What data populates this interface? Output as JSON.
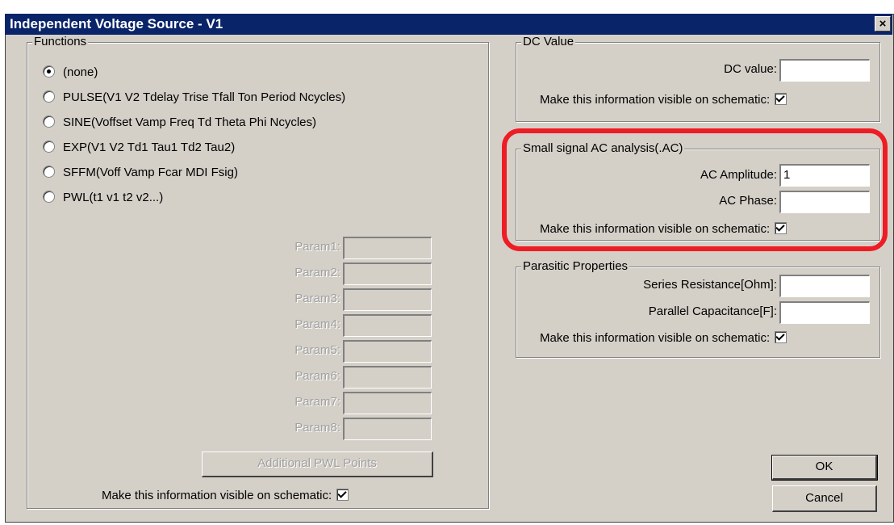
{
  "window": {
    "title": "Independent Voltage Source - V1",
    "close_label": "×"
  },
  "functions": {
    "title": "Functions",
    "options": [
      {
        "label": "(none)",
        "selected": true
      },
      {
        "label": "PULSE(V1 V2 Tdelay Trise Tfall Ton Period Ncycles)",
        "selected": false
      },
      {
        "label": "SINE(Voffset Vamp Freq Td Theta Phi Ncycles)",
        "selected": false
      },
      {
        "label": "EXP(V1 V2 Td1 Tau1 Td2 Tau2)",
        "selected": false
      },
      {
        "label": "SFFM(Voff Vamp Fcar MDI Fsig)",
        "selected": false
      },
      {
        "label": "PWL(t1 v1 t2 v2...)",
        "selected": false
      }
    ],
    "params": [
      {
        "label": "Param1:",
        "value": ""
      },
      {
        "label": "Param2:",
        "value": ""
      },
      {
        "label": "Param3:",
        "value": ""
      },
      {
        "label": "Param4:",
        "value": ""
      },
      {
        "label": "Param5:",
        "value": ""
      },
      {
        "label": "Param6:",
        "value": ""
      },
      {
        "label": "Param7:",
        "value": ""
      },
      {
        "label": "Param8:",
        "value": ""
      }
    ],
    "pwl_button": "Additional PWL Points",
    "visible_label": "Make this information visible on schematic:",
    "visible_checked": true
  },
  "dc": {
    "title": "DC Value",
    "value_label": "DC value:",
    "value": "",
    "visible_label": "Make this information visible on schematic:",
    "visible_checked": true
  },
  "ac": {
    "title": "Small signal AC analysis(.AC)",
    "amplitude_label": "AC Amplitude:",
    "amplitude": "1",
    "phase_label": "AC Phase:",
    "phase": "",
    "visible_label": "Make this information visible on schematic:",
    "visible_checked": true
  },
  "parasitic": {
    "title": "Parasitic Properties",
    "series_label": "Series Resistance[Ohm]:",
    "series_value": "",
    "parallel_label": "Parallel Capacitance[F]:",
    "parallel_value": "",
    "visible_label": "Make this information visible on schematic:",
    "visible_checked": true
  },
  "buttons": {
    "ok": "OK",
    "cancel": "Cancel"
  },
  "colors": {
    "title_bar": "#0a246a",
    "dialog_face": "#d4d0c8",
    "highlight": "#ee1c24"
  }
}
